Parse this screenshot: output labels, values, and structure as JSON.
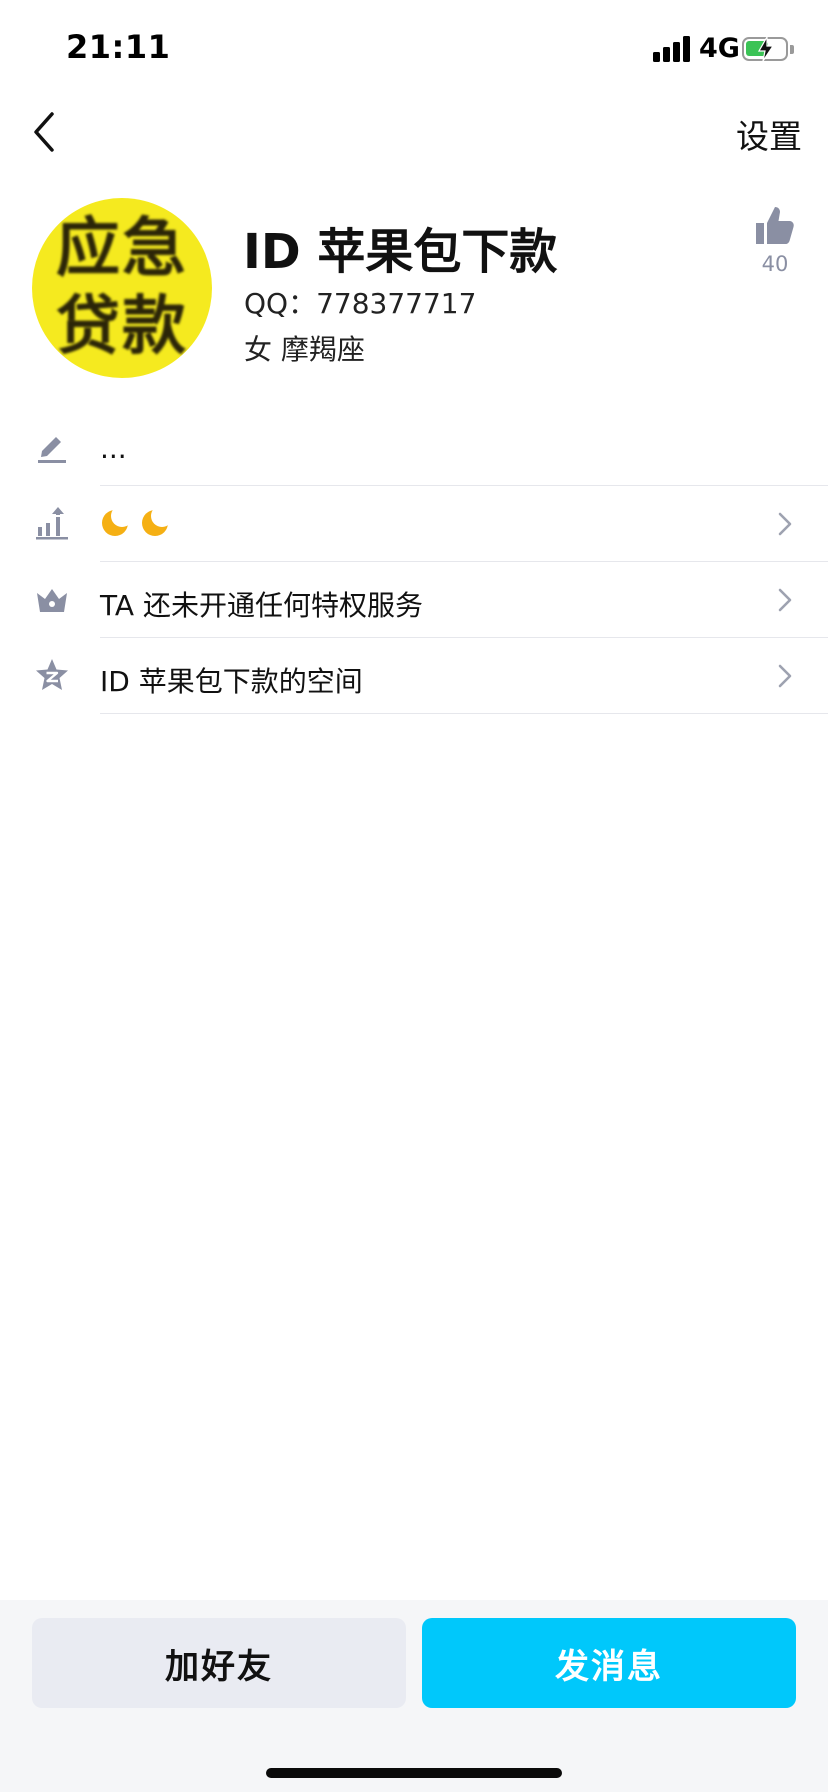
{
  "status_bar": {
    "time": "21:11",
    "network": "4G"
  },
  "nav": {
    "settings_label": "设置"
  },
  "profile": {
    "avatar_text": [
      "应急",
      "贷款"
    ],
    "nickname": "ID 苹果包下款",
    "qq": "QQ：778377717",
    "gender_sign": "女  摩羯座",
    "likes": "40"
  },
  "rows": [
    {
      "icon": "edit-pencil-icon",
      "text": "..."
    },
    {
      "icon": "level-up-icon",
      "badges": [
        "moon",
        "moon"
      ]
    },
    {
      "icon": "vip-crown-icon",
      "text": "TA 还未开通任何特权服务"
    },
    {
      "icon": "qzone-star-icon",
      "text": "ID 苹果包下款的空间"
    }
  ],
  "actions": {
    "add_friend": "加好友",
    "send_message": "发消息"
  },
  "colors": {
    "primary": "#00c8fb",
    "secondary_button": "#e9ebf2",
    "icon_gray": "#8a8fa3",
    "avatar_bg": "#f5ea1f"
  }
}
